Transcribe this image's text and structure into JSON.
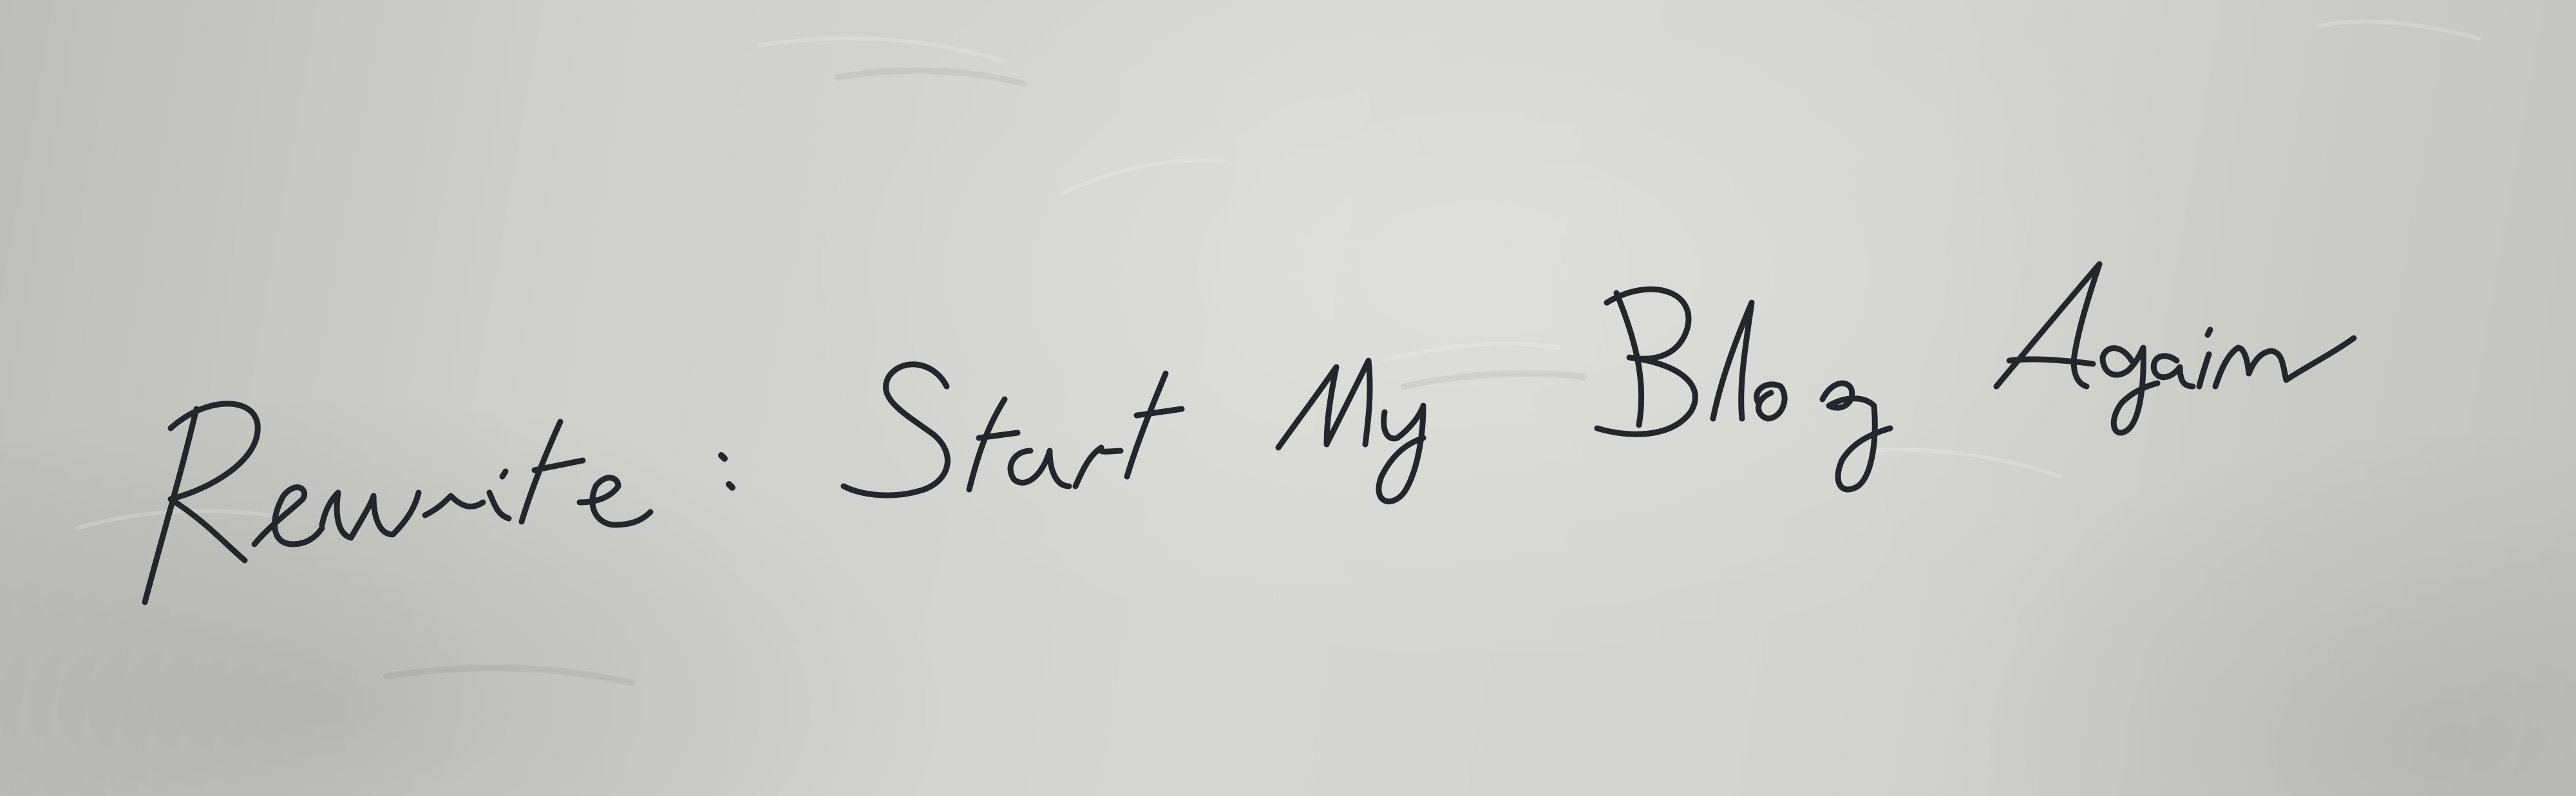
{
  "photo": {
    "subject": "handwritten note on paper",
    "handwritten_text": "Rewrite : Start My Blog Again",
    "paper_color": "#d2d2d0",
    "ink_color": "#252629"
  }
}
